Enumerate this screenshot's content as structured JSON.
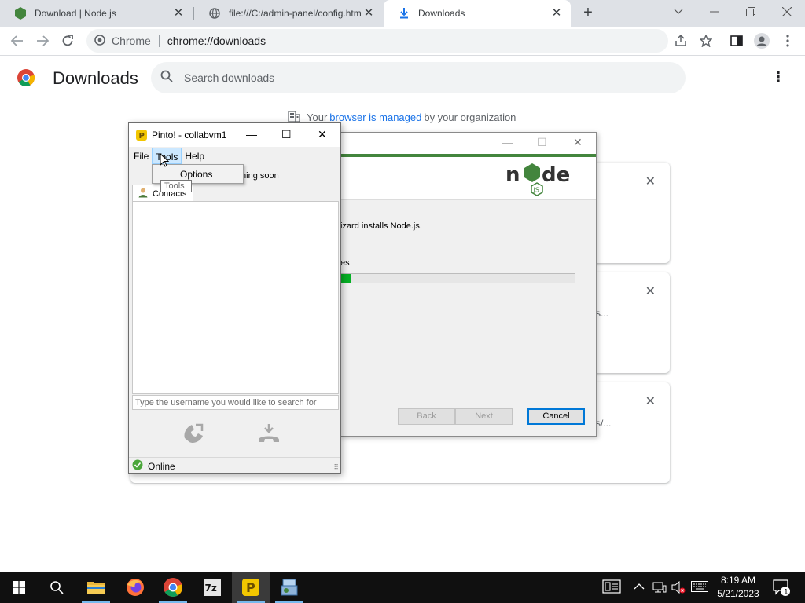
{
  "browser": {
    "tabs": [
      {
        "label": "Download | Node.js",
        "icon": "nodejs-icon",
        "active": false
      },
      {
        "label": "file:///C:/admin-panel/config.htm",
        "icon": "globe-icon",
        "active": false
      },
      {
        "label": "Downloads",
        "icon": "download-icon",
        "active": true
      }
    ],
    "new_tab": "+",
    "omnibox": {
      "chip": "Chrome",
      "url": "chrome://downloads"
    }
  },
  "downloads_page": {
    "title": "Downloads",
    "search_placeholder": "Search downloads",
    "managed_prefix": "Your",
    "managed_link": "browser is managed",
    "managed_suffix": "by your organization",
    "card_fragments": [
      "s...",
      "s/..."
    ]
  },
  "node_installer": {
    "intro_fragment": "izard installs Node.js.",
    "status_fragment": "es",
    "progress_fraction": 0.04,
    "buttons": {
      "back": "Back",
      "next": "Next",
      "cancel": "Cancel"
    }
  },
  "pinto": {
    "title": "Pinto! - collabvm1",
    "menu": {
      "file": "File",
      "tools": "Tools",
      "help": "Help"
    },
    "status_fragment": "ming soon",
    "contacts_tab": "Contacts",
    "search_placeholder": "Type the username you would like to search for",
    "status": "Online",
    "dropdown_item": "Options",
    "tooltip": "Tools"
  },
  "taskbar": {
    "time": "8:19 AM",
    "date": "5/21/2023",
    "notification_count": "1"
  },
  "colors": {
    "node_green": "#43853d",
    "progress_green": "#06b025",
    "link_blue": "#1a73e8",
    "taskbar": "#101010"
  }
}
